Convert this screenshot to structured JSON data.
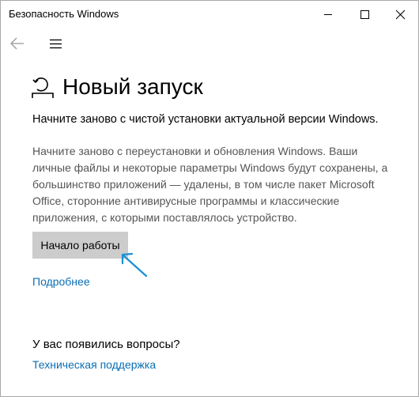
{
  "window": {
    "title": "Безопасность Windows"
  },
  "page": {
    "title": "Новый запуск",
    "subtitle": "Начните заново с чистой установки актуальной версии Windows.",
    "description_lines": [
      "Начните заново с переустановки и обновления Windows. Ваши",
      "личные файлы и некоторые параметры Windows будут сохранены, а",
      "большинство приложений — удалены, в том числе пакет Microsoft",
      "Office, сторонние антивирусные программы и классические",
      "приложения, с которыми поставлялось устройство."
    ],
    "start_button_label": "Начало работы",
    "more_link": "Подробнее",
    "questions_heading": "У вас появились вопросы?",
    "support_link": "Техническая поддержка"
  },
  "icons": {
    "back": "back-arrow-icon",
    "menu": "hamburger-menu-icon",
    "heading": "fresh-start-icon",
    "annotation": "annotation-arrow"
  },
  "colors": {
    "link": "#0a6eb4",
    "button_bg": "#cccccc",
    "description_text": "#555555",
    "annotation_arrow": "#1a8fd6"
  }
}
